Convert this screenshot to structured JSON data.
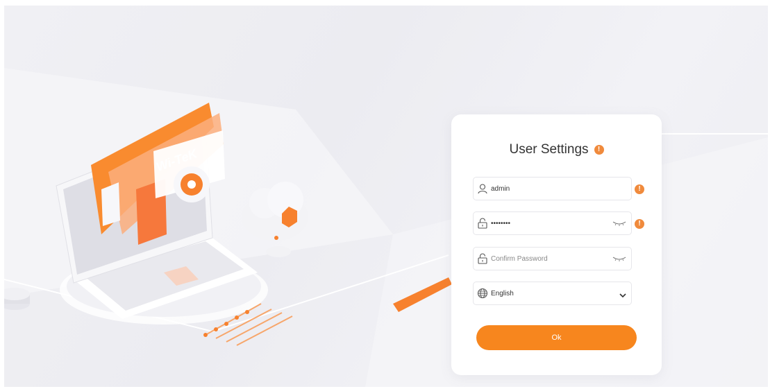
{
  "brand": {
    "logo_text": "Wi-TeK"
  },
  "form": {
    "title": "User Settings",
    "warning_glyph": "!",
    "username": {
      "value": "admin",
      "icon": "user-icon"
    },
    "password": {
      "value": "••••••••",
      "icon": "lock-icon",
      "toggle_icon": "eye-closed-icon"
    },
    "confirm_password": {
      "placeholder": "Confirm Password",
      "icon": "lock-icon",
      "toggle_icon": "eye-closed-icon"
    },
    "language": {
      "selected": "English",
      "icon": "globe-icon",
      "dropdown_icon": "chevron-down-icon"
    },
    "ok_label": "Ok"
  },
  "colors": {
    "accent": "#f7861e",
    "warning": "#f08a3c",
    "background": "#efeff3"
  }
}
